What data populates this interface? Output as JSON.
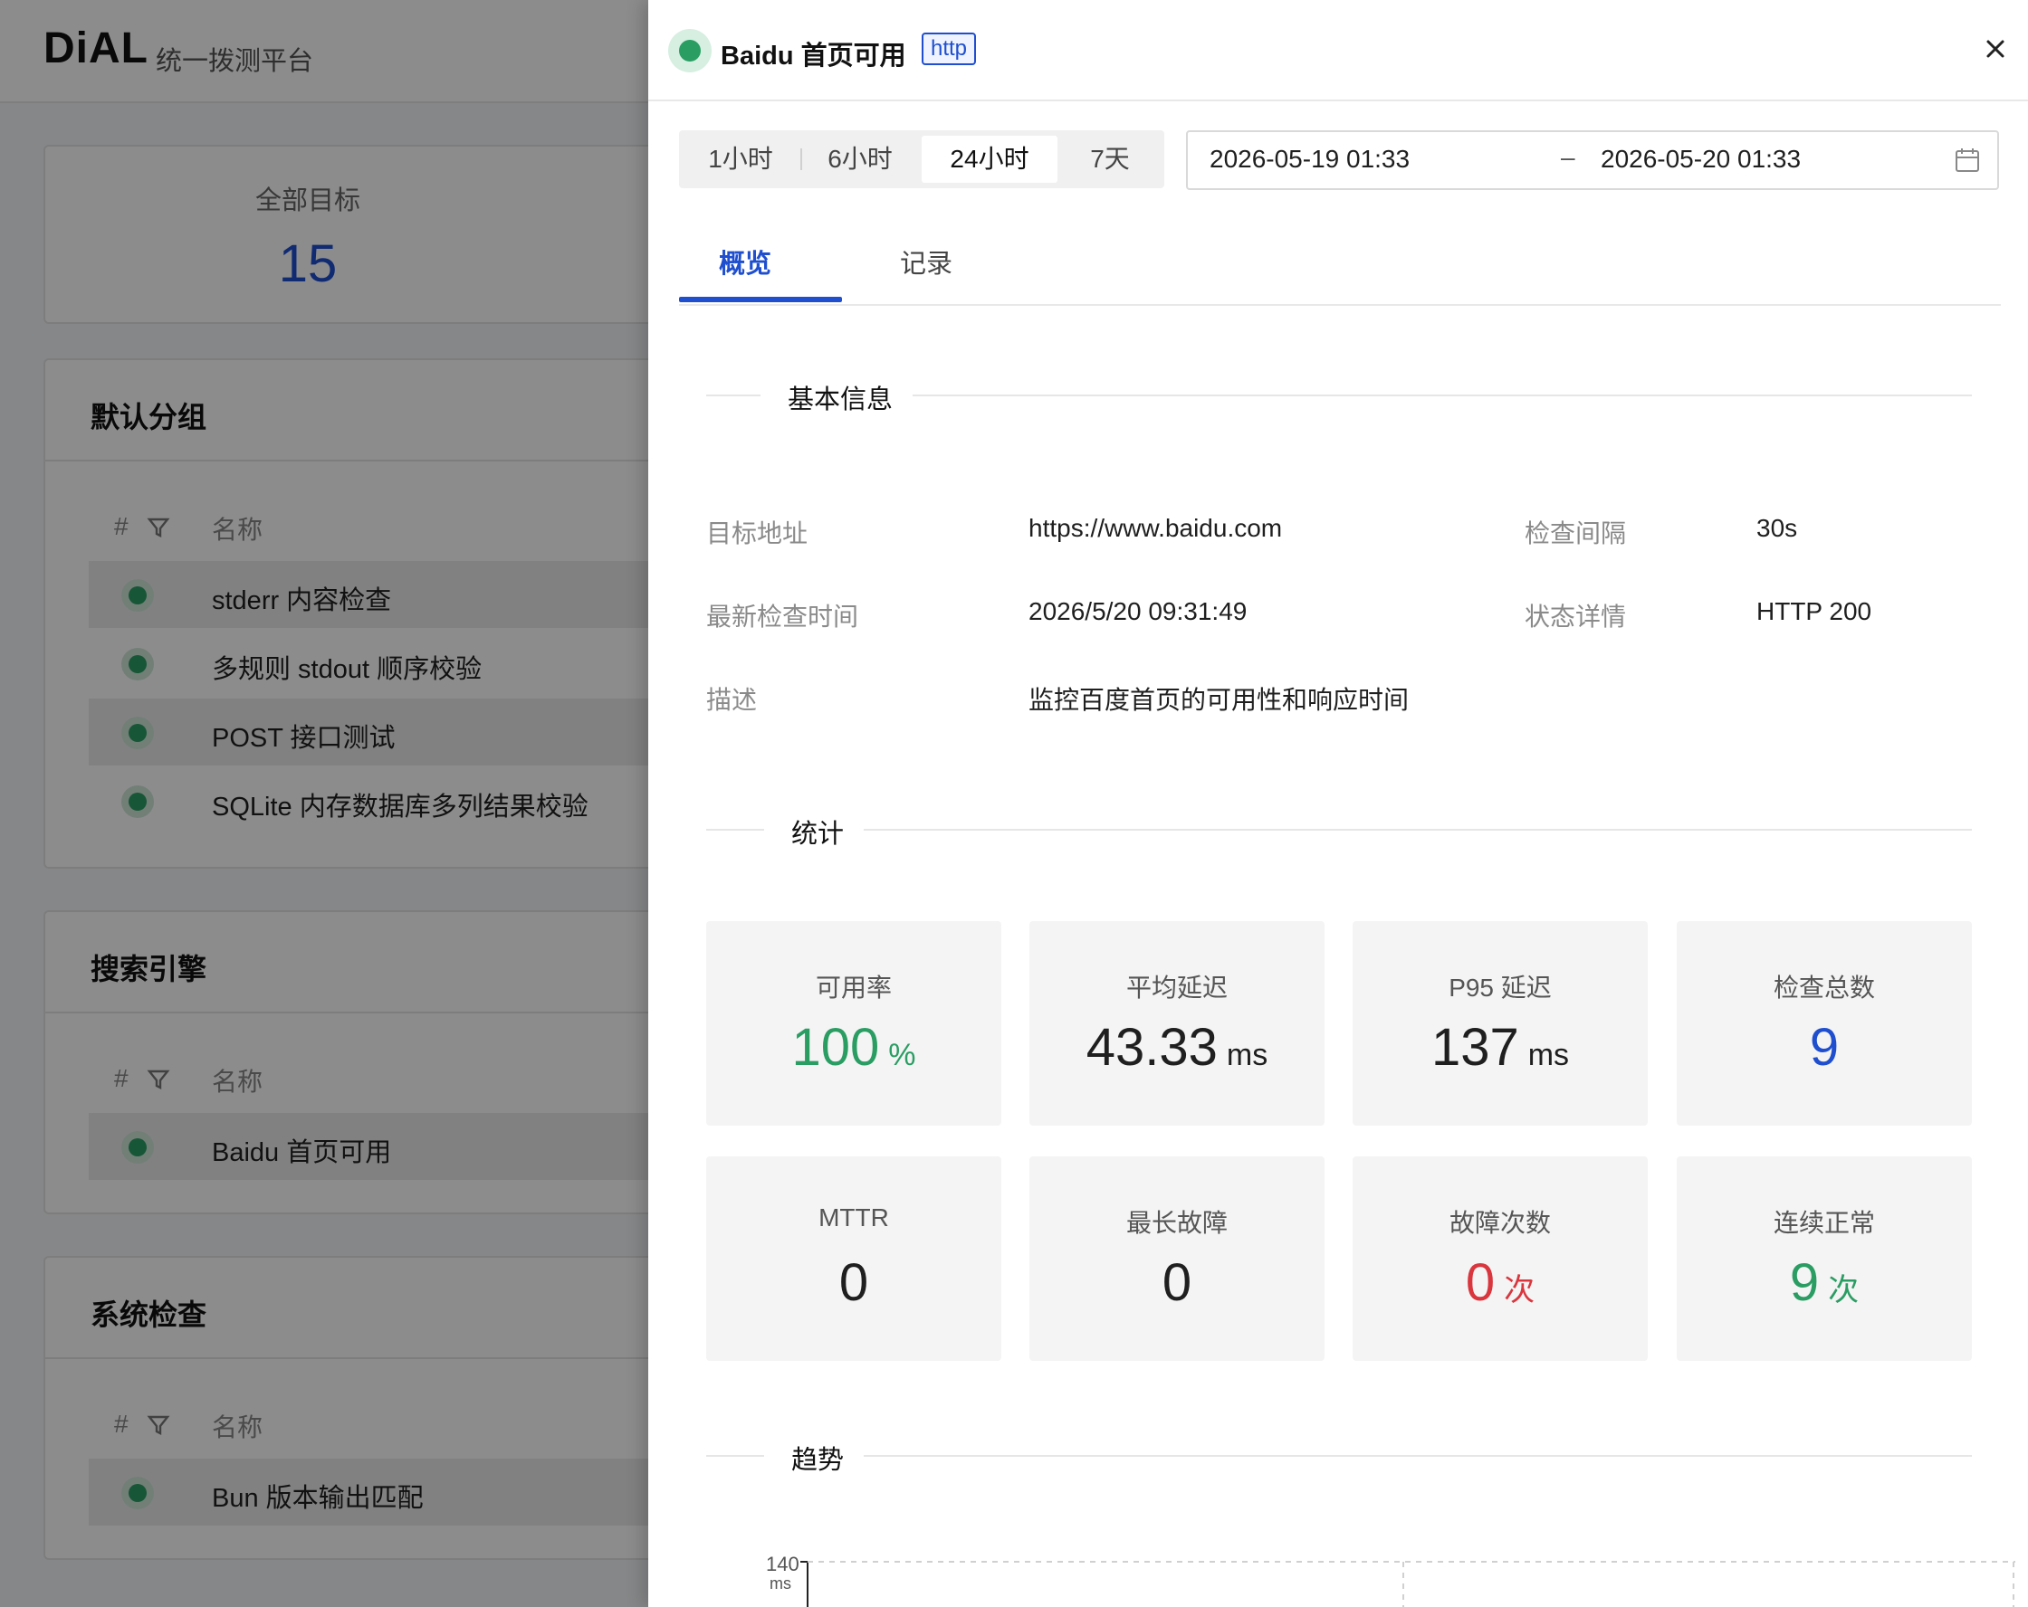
{
  "app": {
    "logo": "DiAL",
    "subtitle": "统一拨测平台"
  },
  "summary": {
    "label": "全部目标",
    "value": "15"
  },
  "groups": [
    {
      "title": "默认分组",
      "col_hash": "#",
      "col_name": "名称",
      "items": [
        "stderr 内容检查",
        "多规则 stdout 顺序校验",
        "POST 接口测试",
        "SQLite 内存数据库多列结果校验"
      ]
    },
    {
      "title": "搜索引擎",
      "col_hash": "#",
      "col_name": "名称",
      "items": [
        "Baidu 首页可用"
      ]
    },
    {
      "title": "系统检查",
      "col_hash": "#",
      "col_name": "名称",
      "items": [
        "Bun 版本输出匹配"
      ]
    }
  ],
  "drawer": {
    "title": "Baidu 首页可用",
    "tag": "http",
    "status_color": "#2a9d63",
    "close_icon": "close-icon",
    "ranges": [
      "1小时",
      "6小时",
      "24小时",
      "7天"
    ],
    "active_range": "24小时",
    "date_start": "2026-05-19 01:33",
    "date_sep": "–",
    "date_end": "2026-05-20 01:33",
    "tabs": [
      "概览",
      "记录"
    ],
    "active_tab": "概览",
    "basic_info": {
      "section_title": "基本信息",
      "target_label": "目标地址",
      "target_value": "https://www.baidu.com",
      "interval_label": "检查间隔",
      "interval_value": "30s",
      "last_check_label": "最新检查时间",
      "last_check_value": "2026/5/20 09:31:49",
      "status_label": "状态详情",
      "status_value": "HTTP 200",
      "desc_label": "描述",
      "desc_value": "监控百度首页的可用性和响应时间"
    },
    "stats": {
      "section_title": "统计",
      "items": [
        {
          "label": "可用率",
          "value": "100",
          "unit": "%",
          "color": "green"
        },
        {
          "label": "平均延迟",
          "value": "43.33",
          "unit": "ms",
          "color": "dark"
        },
        {
          "label": "P95 延迟",
          "value": "137",
          "unit": "ms",
          "color": "dark"
        },
        {
          "label": "检查总数",
          "value": "9",
          "unit": "",
          "color": "blue"
        },
        {
          "label": "MTTR",
          "value": "0",
          "unit": "",
          "color": "dark"
        },
        {
          "label": "最长故障",
          "value": "0",
          "unit": "",
          "color": "dark"
        },
        {
          "label": "故障次数",
          "value": "0",
          "unit": "次",
          "color": "red"
        },
        {
          "label": "连续正常",
          "value": "9",
          "unit": "次",
          "color": "green"
        }
      ]
    },
    "trend": {
      "section_title": "趋势",
      "y_top_label": "140",
      "y_unit": "ms"
    }
  },
  "colors": {
    "accent": "#1f4fcf",
    "success": "#2a9d63",
    "danger": "#d9363e"
  }
}
